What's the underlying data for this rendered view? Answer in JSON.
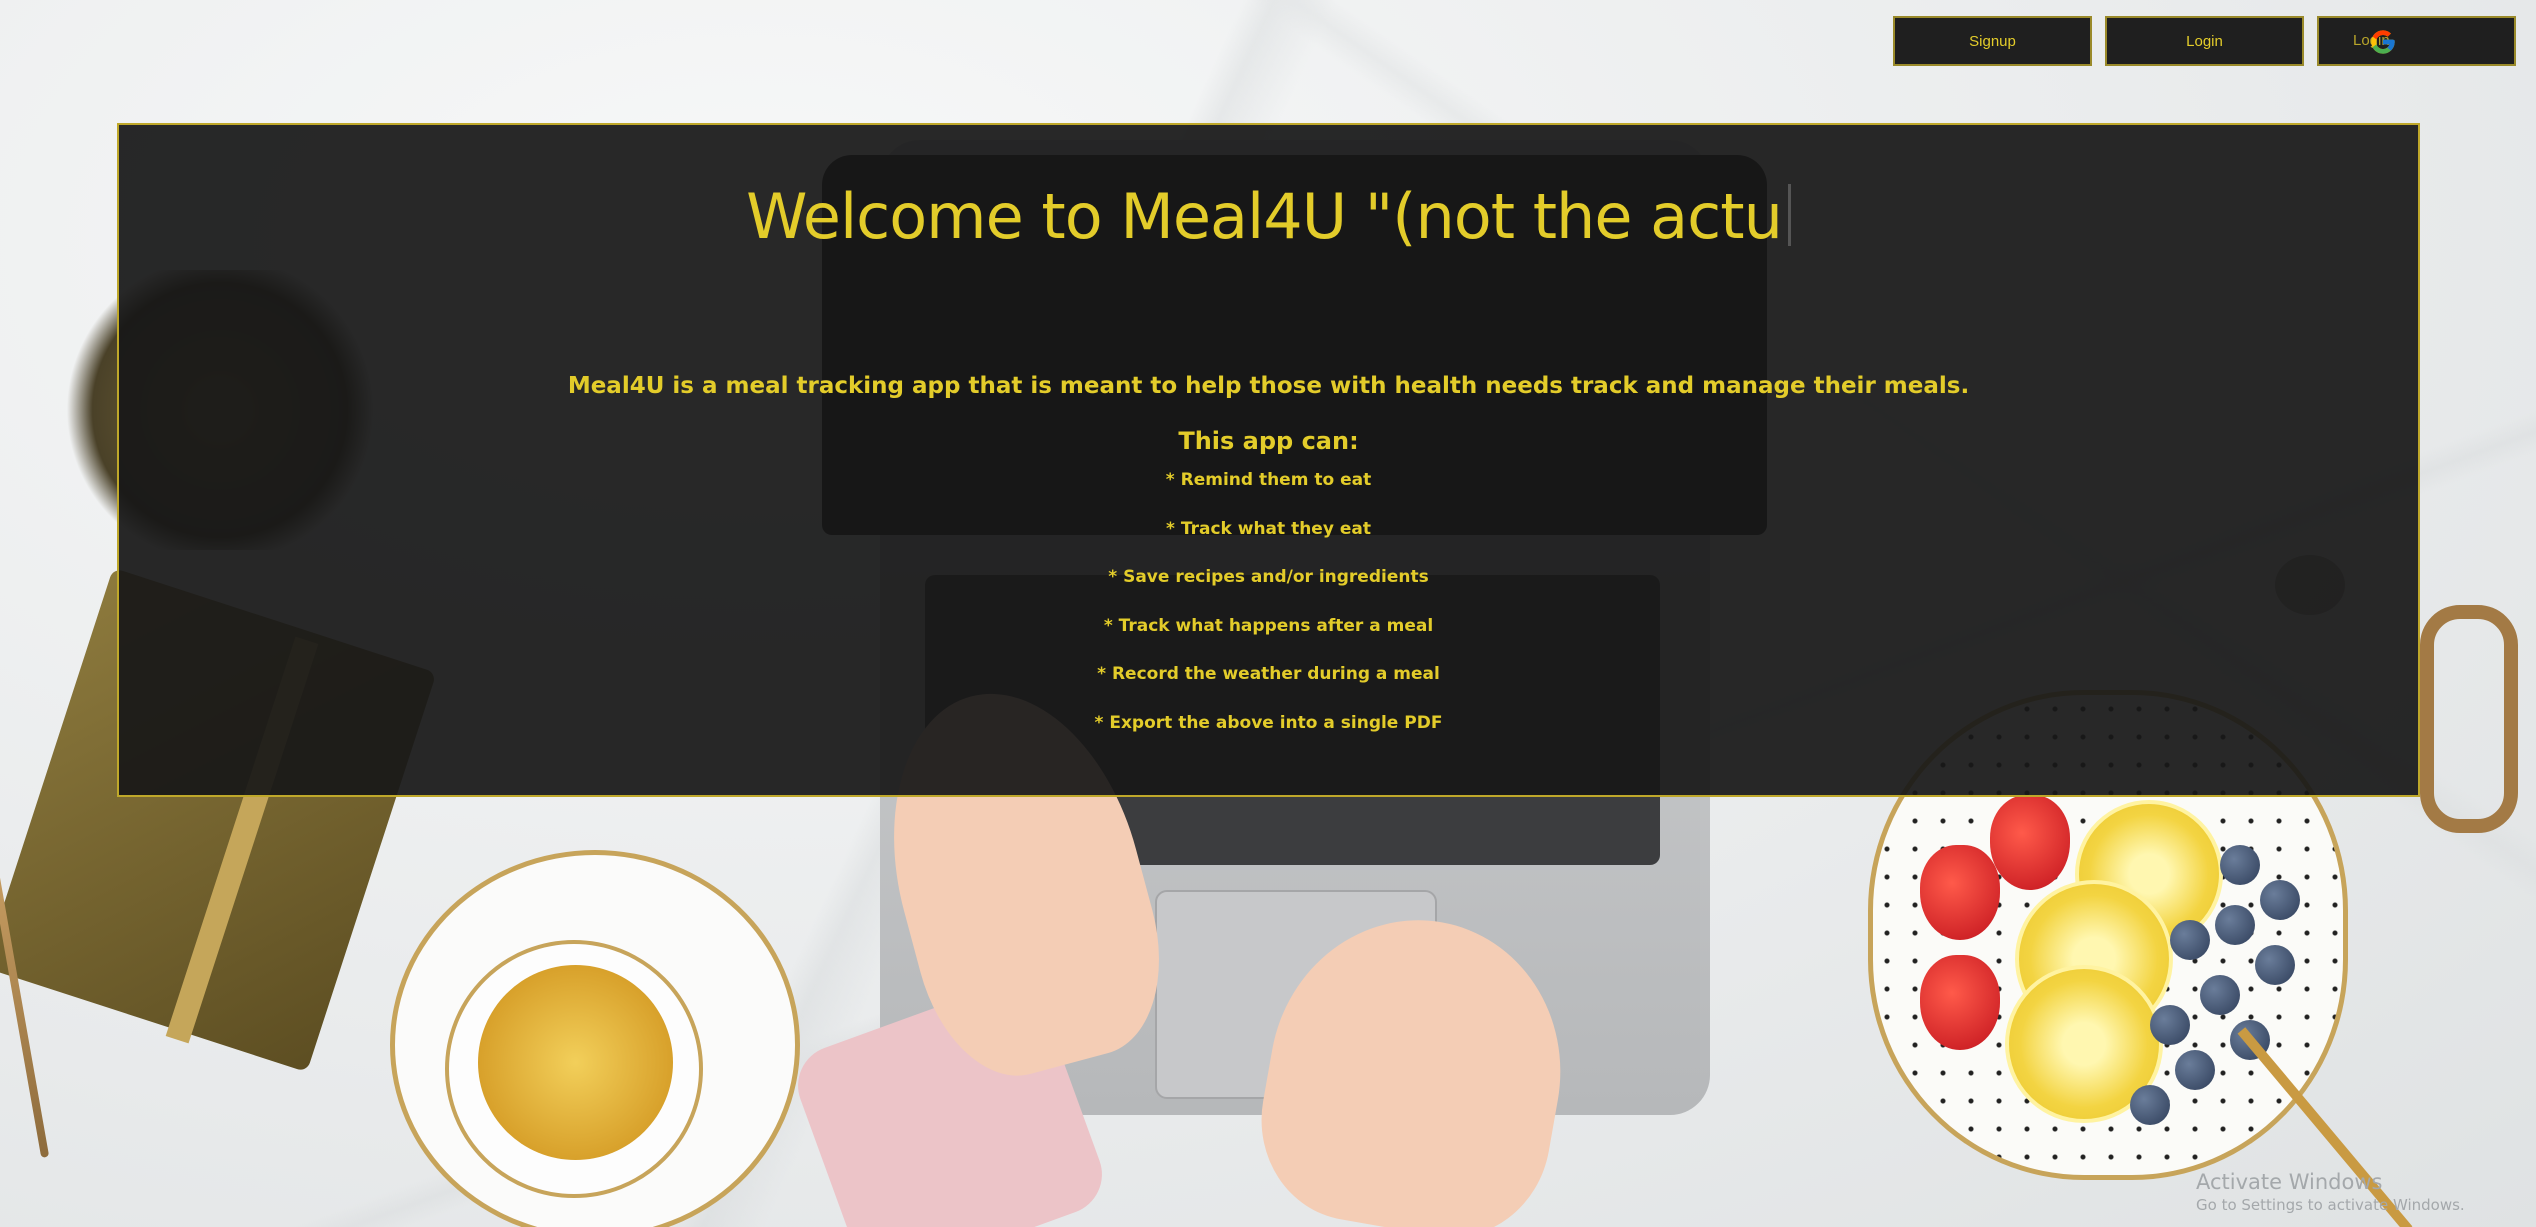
{
  "header": {
    "signup_label": "Signup",
    "login_label": "Login",
    "google_login_label": "Login"
  },
  "main": {
    "title": "Welcome to Meal4U \"(not the actu",
    "intro": "Meal4U is a meal tracking app that is meant to help those with health needs track and manage their meals.",
    "subheading": "This app can:",
    "features": [
      "* Remind them to eat",
      "* Track what they eat",
      "* Save recipes and/or ingredients",
      "* Track what happens after a meal",
      "* Record the weather during a meal",
      "* Export the above into a single PDF"
    ]
  },
  "watermark": {
    "title": "Activate Windows",
    "subtitle": "Go to Settings to activate Windows."
  },
  "icons": [
    "google-icon"
  ],
  "colors": {
    "accent": "#e3cc2a",
    "panel": "#181818",
    "button_bg": "#1f1f1f"
  }
}
